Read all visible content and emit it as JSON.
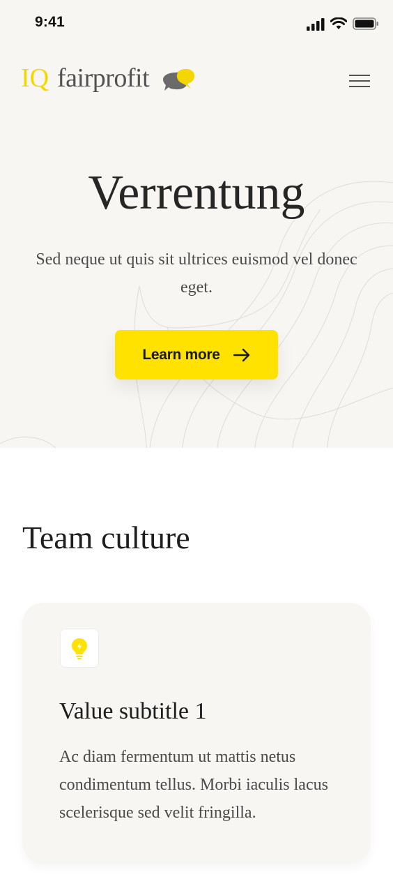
{
  "status_bar": {
    "time": "9:41",
    "icons": [
      "cellular-signal-icon",
      "wifi-icon",
      "battery-icon"
    ]
  },
  "header": {
    "logo_prefix": "IQ",
    "logo_word": "fairprofit",
    "logo_mark_icon": "speech-bubbles-icon",
    "menu_icon": "hamburger-menu-icon"
  },
  "hero": {
    "title": "Verrentung",
    "text": "Sed neque ut quis sit ultrices euismod vel donec eget.",
    "cta_label": "Learn more",
    "cta_icon": "arrow-right-icon"
  },
  "team_culture": {
    "title": "Team culture",
    "cards": [
      {
        "icon": "lightbulb-icon",
        "title": "Value subtitle 1",
        "text": "Ac diam fermentum ut mattis netus condimentum tellus. Morbi iaculis lacus scelerisque sed velit fringilla."
      }
    ]
  },
  "colors": {
    "accent_yellow": "#ffe200",
    "logo_yellow": "#f4d700",
    "hero_background": "#f7f6f2",
    "text_dark": "#262626",
    "text_muted": "#4a4a4a"
  }
}
